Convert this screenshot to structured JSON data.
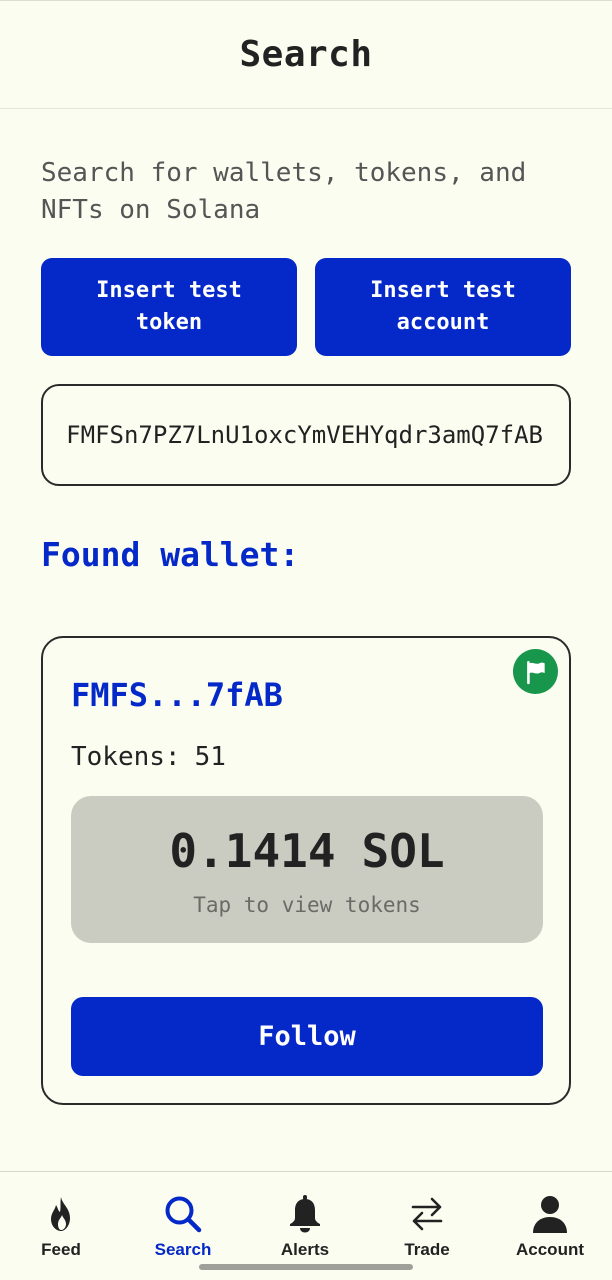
{
  "header": {
    "title": "Search"
  },
  "description": "Search for wallets, tokens, and NFTs on Solana",
  "buttons": {
    "insert_token": "Insert test token",
    "insert_account": "Insert test account"
  },
  "search": {
    "value": "FMFSn7PZ7LnU1oxcYmVEHYqdr3amQ7fAB"
  },
  "result": {
    "title": "Found wallet:",
    "wallet": {
      "address_short": "FMFS...7fAB",
      "tokens_label": "Tokens:",
      "tokens_count": "51",
      "balance_amount": "0.1414",
      "balance_unit": "SOL",
      "balance_hint": "Tap to view tokens",
      "follow_label": "Follow",
      "flag_color": "#18964b"
    }
  },
  "tabs": [
    {
      "label": "Feed",
      "icon": "flame-icon",
      "active": false
    },
    {
      "label": "Search",
      "icon": "search-icon",
      "active": true
    },
    {
      "label": "Alerts",
      "icon": "bell-icon",
      "active": false
    },
    {
      "label": "Trade",
      "icon": "swap-icon",
      "active": false
    },
    {
      "label": "Account",
      "icon": "person-icon",
      "active": false
    }
  ],
  "colors": {
    "accent": "#0528c8",
    "background": "#fbfdf0",
    "balance_box": "#cbccc1"
  }
}
